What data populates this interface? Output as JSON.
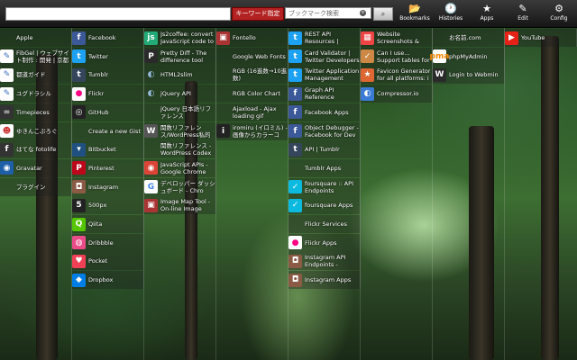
{
  "toolbar": {
    "keyword_button": "キーワード指定",
    "bookmark_search_placeholder": "ブックマーク検索",
    "clear": "×",
    "search": "⌕",
    "nav": [
      {
        "label": "Bookmarks",
        "icon": "📂",
        "name": "bookmarks"
      },
      {
        "label": "Histories",
        "icon": "🕐",
        "name": "histories"
      },
      {
        "label": "Apps",
        "icon": "★",
        "name": "apps"
      },
      {
        "label": "Edit",
        "icon": "✎",
        "name": "edit"
      },
      {
        "label": "Config",
        "icon": "⚙",
        "name": "config"
      }
    ]
  },
  "columns": [
    {
      "items": [
        {
          "label": "Apple",
          "glyph": "",
          "fg": "#fff",
          "bg": "transparent"
        },
        {
          "label": "FibGel | ウェブサイト制作 : 開発 | 京都",
          "glyph": "✎",
          "fg": "#3a6fc0",
          "bg": "#fff"
        },
        {
          "label": "都道ガイド",
          "glyph": "✎",
          "fg": "#3a6fc0",
          "bg": "#fff"
        },
        {
          "label": "ユグドラシル",
          "glyph": "✎",
          "fg": "#3a6fc0",
          "bg": "#fff"
        },
        {
          "label": "Timepieces",
          "glyph": "∞",
          "fg": "#ddd",
          "bg": "#333"
        },
        {
          "label": "ゆきんこぷろぐ",
          "glyph": "☻",
          "fg": "#c33",
          "bg": "#fff"
        },
        {
          "label": "はてな fotolife",
          "glyph": "f",
          "fg": "#fff",
          "bg": "#333"
        },
        {
          "label": "Gravatar",
          "glyph": "◉",
          "fg": "#fff",
          "bg": "#1e5fa8"
        },
        {
          "label": "プラグイン",
          "glyph": "",
          "fg": "#fff",
          "bg": "transparent"
        }
      ]
    },
    {
      "items": [
        {
          "label": "Facebook",
          "glyph": "f",
          "fg": "#fff",
          "bg": "#3b5998"
        },
        {
          "label": "Twitter",
          "glyph": "t",
          "fg": "#fff",
          "bg": "#1da1f2"
        },
        {
          "label": "Tumblr",
          "glyph": "t",
          "fg": "#fff",
          "bg": "#35465c"
        },
        {
          "label": "Flickr",
          "glyph": "●",
          "fg": "#ff0084",
          "bg": "#fff"
        },
        {
          "label": "GitHub",
          "glyph": "◎",
          "fg": "#fff",
          "bg": "#222"
        },
        {
          "label": "Create a new Gist",
          "glyph": "",
          "fg": "#fff",
          "bg": "transparent"
        },
        {
          "label": "Bitbucket",
          "glyph": "▾",
          "fg": "#fff",
          "bg": "#205081"
        },
        {
          "label": "Pinterest",
          "glyph": "P",
          "fg": "#fff",
          "bg": "#bd081c"
        },
        {
          "label": "Instagram",
          "glyph": "◘",
          "fg": "#fff",
          "bg": "#8a5a44"
        },
        {
          "label": "500px",
          "glyph": "5",
          "fg": "#fff",
          "bg": "#222"
        },
        {
          "label": "Qiita",
          "glyph": "Q",
          "fg": "#fff",
          "bg": "#55c500"
        },
        {
          "label": "Dribbble",
          "glyph": "◍",
          "fg": "#fff",
          "bg": "#ea4c89"
        },
        {
          "label": "Pocket",
          "glyph": "♥",
          "fg": "#fff",
          "bg": "#ef4056"
        },
        {
          "label": "Dropbox",
          "glyph": "◆",
          "fg": "#fff",
          "bg": "#007ee5"
        }
      ]
    },
    {
      "items": [
        {
          "label": "Js2coffee: convert JavaScript code to",
          "glyph": "js",
          "fg": "#fff",
          "bg": "#2a7"
        },
        {
          "label": "Pretty Diff - The difference tool",
          "glyph": "P",
          "fg": "#fff",
          "bg": "#2a2a2a"
        },
        {
          "label": "HTML2slim",
          "glyph": "◐",
          "fg": "#9bd",
          "bg": "transparent"
        },
        {
          "label": "jQuery API",
          "glyph": "◐",
          "fg": "#9bd",
          "bg": "transparent"
        },
        {
          "label": "jQuery 日本語リファレンス",
          "glyph": "",
          "fg": "#fff",
          "bg": "transparent"
        },
        {
          "label": "関数リファレンス/WordPress私的マニュアル",
          "glyph": "W",
          "fg": "#fff",
          "bg": "#555"
        },
        {
          "label": "関数リファレンス - WordPress Codex",
          "glyph": "",
          "fg": "#fff",
          "bg": "transparent"
        },
        {
          "label": "JavaScript APIs - Google Chrome",
          "glyph": "◉",
          "fg": "#fff",
          "bg": "#db4437"
        },
        {
          "label": "デベロッパー ダッシュボード - Chro",
          "glyph": "G",
          "fg": "#4285f4",
          "bg": "#fff"
        },
        {
          "label": "Image Map Tool - On-line Image Map",
          "glyph": "▣",
          "fg": "#fff",
          "bg": "#a33"
        }
      ]
    },
    {
      "items": [
        {
          "label": "Fontello",
          "glyph": "▣",
          "fg": "#fff",
          "bg": "#a33"
        },
        {
          "label": "Google Web Fonts",
          "glyph": "",
          "fg": "#fff",
          "bg": "transparent"
        },
        {
          "label": "RGB (16進数→10進数)",
          "glyph": "",
          "fg": "#fff",
          "bg": "transparent"
        },
        {
          "label": "RGB Color Chart",
          "glyph": "",
          "fg": "#fff",
          "bg": "transparent"
        },
        {
          "label": "Ajaxload - Ajax loading gif generator",
          "glyph": "",
          "fg": "#fff",
          "bg": "transparent"
        },
        {
          "label": "iromiru (イロミル) - 画像からカラーコ",
          "glyph": "i",
          "fg": "#fff",
          "bg": "#222"
        }
      ]
    },
    {
      "items": [
        {
          "label": "REST API Resources | Twitter Develo",
          "glyph": "t",
          "fg": "#fff",
          "bg": "#1da1f2"
        },
        {
          "label": "Card Validator | Twitter Developers",
          "glyph": "t",
          "fg": "#fff",
          "bg": "#1da1f2"
        },
        {
          "label": "Twitter Application Management",
          "glyph": "t",
          "fg": "#fff",
          "bg": "#1da1f2"
        },
        {
          "label": "Graph API Reference",
          "glyph": "f",
          "fg": "#fff",
          "bg": "#3b5998"
        },
        {
          "label": "Facebook Apps",
          "glyph": "f",
          "fg": "#fff",
          "bg": "#3b5998"
        },
        {
          "label": "Object Debugger - Facebook for Dev",
          "glyph": "f",
          "fg": "#fff",
          "bg": "#3b5998"
        },
        {
          "label": "API | Tumblr",
          "glyph": "t",
          "fg": "#fff",
          "bg": "#35465c"
        },
        {
          "label": "Tumblr Apps",
          "glyph": "",
          "fg": "#fff",
          "bg": "transparent"
        },
        {
          "label": "foursquare :: API Endpoints",
          "glyph": "✓",
          "fg": "#fff",
          "bg": "#0cbadf"
        },
        {
          "label": "foursquare Apps",
          "glyph": "✓",
          "fg": "#fff",
          "bg": "#0cbadf"
        },
        {
          "label": "Flickr Services",
          "glyph": "",
          "fg": "#fff",
          "bg": "transparent"
        },
        {
          "label": "Flickr Apps",
          "glyph": "●",
          "fg": "#ff0084",
          "bg": "#fff"
        },
        {
          "label": "Instagram API Endpoints - Instagram",
          "glyph": "◘",
          "fg": "#fff",
          "bg": "#8a5a44"
        },
        {
          "label": "Instagram Apps",
          "glyph": "◘",
          "fg": "#fff",
          "bg": "#8a5a44"
        }
      ]
    },
    {
      "items": [
        {
          "label": "Website Screenshots & Responsive De",
          "glyph": "▦",
          "fg": "#fff",
          "bg": "#e44"
        },
        {
          "label": "Can I use... Support tables for HTML",
          "glyph": "✓",
          "fg": "#fff",
          "bg": "#c84"
        },
        {
          "label": "Favicon Generator for all platforms: i",
          "glyph": "★",
          "fg": "#fff",
          "bg": "#d63"
        },
        {
          "label": "Compressor.io",
          "glyph": "◐",
          "fg": "#fff",
          "bg": "#3a7bd5"
        }
      ]
    },
    {
      "items": [
        {
          "label": "お名前.com",
          "glyph": "",
          "fg": "#fff",
          "bg": "transparent"
        },
        {
          "label": "phpMyAdmin",
          "glyph": "pma",
          "fg": "#f80",
          "bg": "#fff"
        },
        {
          "label": "Login to Webmin",
          "glyph": "W",
          "fg": "#fff",
          "bg": "#2a2a2a"
        }
      ]
    },
    {
      "items": [
        {
          "label": "YouTube",
          "glyph": "▶",
          "fg": "#fff",
          "bg": "#e62117"
        }
      ]
    }
  ]
}
